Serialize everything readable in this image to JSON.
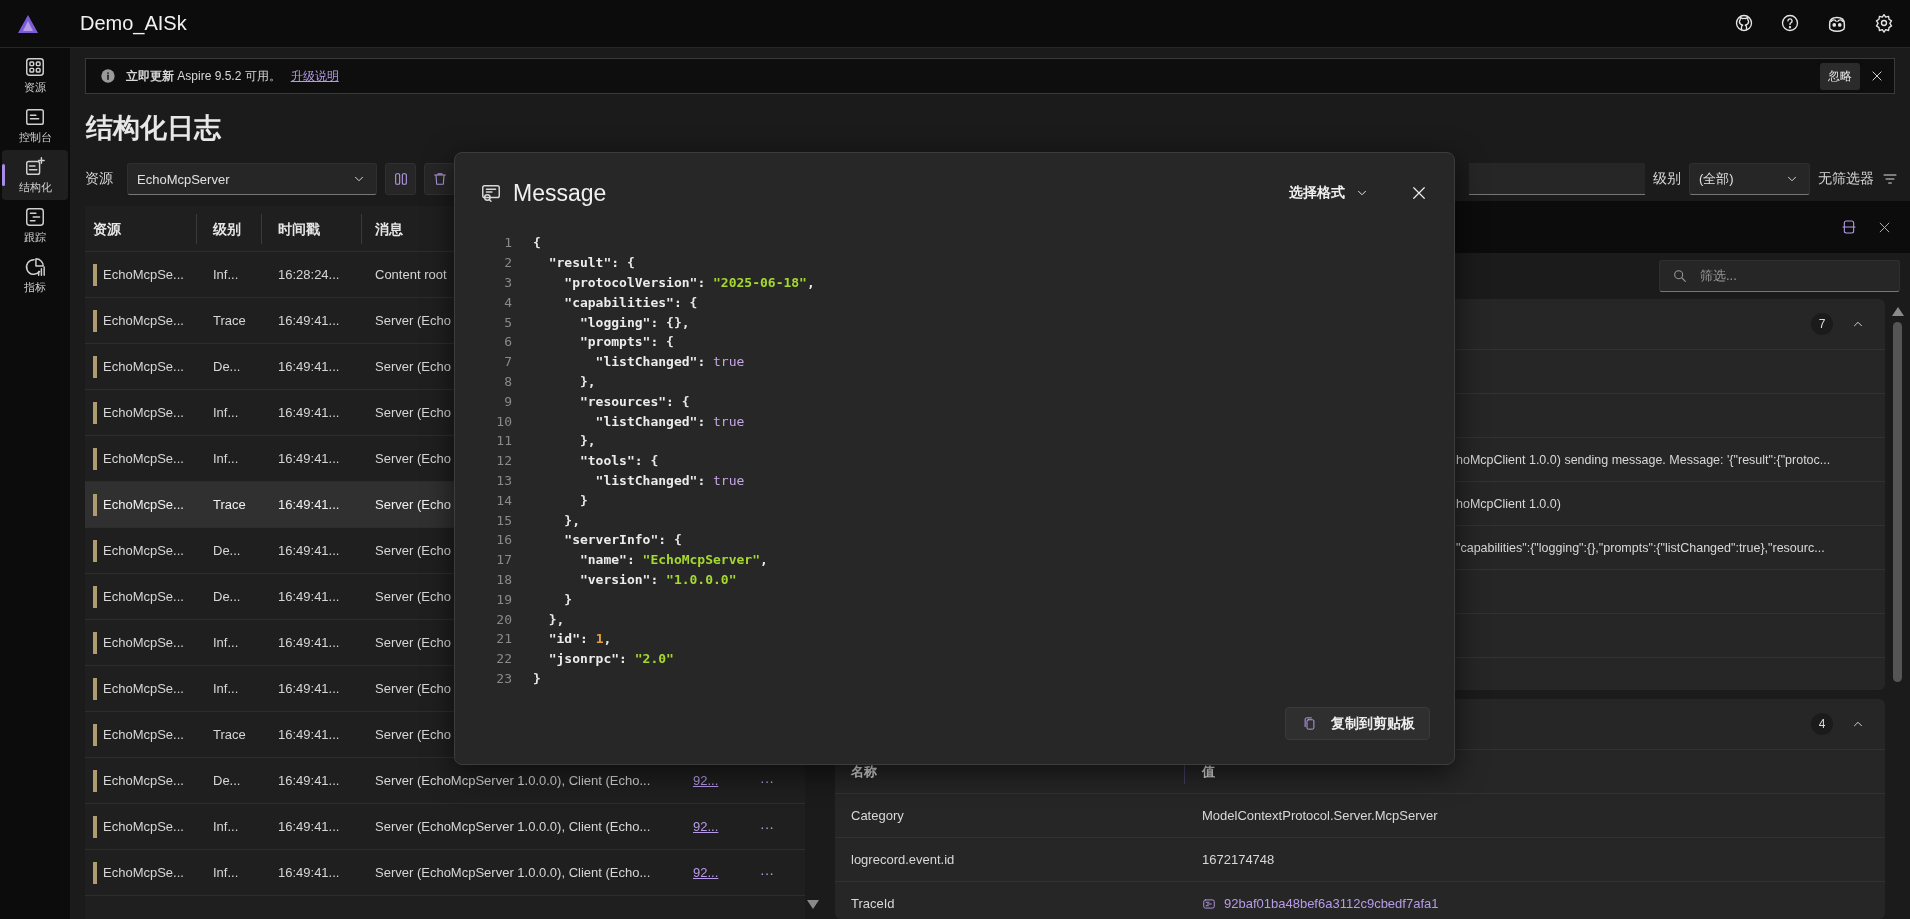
{
  "app": {
    "title": "Demo_AISk"
  },
  "sidebar": {
    "items": [
      {
        "label": "资源",
        "selected": false
      },
      {
        "label": "控制台",
        "selected": false
      },
      {
        "label": "结构化",
        "selected": true
      },
      {
        "label": "跟踪",
        "selected": false
      },
      {
        "label": "指标",
        "selected": false
      }
    ]
  },
  "banner": {
    "text": "**立即更新** Aspire 9.5.2 可用。",
    "link": "升级说明",
    "dismiss_button": "忽略"
  },
  "page_title": "结构化日志",
  "toolbar": {
    "resource_label": "资源",
    "resource_value": "EchoMcpServer",
    "level_label": "级别",
    "level_value": "(全部)",
    "filter_status": "无筛选器"
  },
  "log_table": {
    "columns": [
      "资源",
      "级别",
      "时间戳",
      "消息"
    ],
    "rows": [
      {
        "resource": "EchoMcpSe...",
        "level": "Inf...",
        "timestamp": "16:28:24...",
        "message": "Content root",
        "selected": false
      },
      {
        "resource": "EchoMcpSe...",
        "level": "Trace",
        "timestamp": "16:49:41...",
        "message": "Server (Echo",
        "selected": false
      },
      {
        "resource": "EchoMcpSe...",
        "level": "De...",
        "timestamp": "16:49:41...",
        "message": "Server (Echo",
        "selected": false
      },
      {
        "resource": "EchoMcpSe...",
        "level": "Inf...",
        "timestamp": "16:49:41...",
        "message": "Server (Echo",
        "selected": false
      },
      {
        "resource": "EchoMcpSe...",
        "level": "Inf...",
        "timestamp": "16:49:41...",
        "message": "Server (Echo",
        "selected": false
      },
      {
        "resource": "EchoMcpSe...",
        "level": "Trace",
        "timestamp": "16:49:41...",
        "message": "Server (Echo",
        "selected": true
      },
      {
        "resource": "EchoMcpSe...",
        "level": "De...",
        "timestamp": "16:49:41...",
        "message": "Server (Echo",
        "selected": false
      },
      {
        "resource": "EchoMcpSe...",
        "level": "De...",
        "timestamp": "16:49:41...",
        "message": "Server (Echo",
        "selected": false
      },
      {
        "resource": "EchoMcpSe...",
        "level": "Inf...",
        "timestamp": "16:49:41...",
        "message": "Server (Echo",
        "selected": false
      },
      {
        "resource": "EchoMcpSe...",
        "level": "Inf...",
        "timestamp": "16:49:41...",
        "message": "Server (Echo",
        "selected": false
      },
      {
        "resource": "EchoMcpSe...",
        "level": "Trace",
        "timestamp": "16:49:41...",
        "message": "Server (Echo",
        "selected": false
      },
      {
        "resource": "EchoMcpSe...",
        "level": "De...",
        "timestamp": "16:49:41...",
        "message": "Server (EchoMcpServer 1.0.0.0), Client (Echo...",
        "trace": "92...",
        "actions": "···",
        "selected": false
      },
      {
        "resource": "EchoMcpSe...",
        "level": "Inf...",
        "timestamp": "16:49:41...",
        "message": "Server (EchoMcpServer 1.0.0.0), Client (Echo...",
        "trace": "92...",
        "actions": "···",
        "selected": false
      },
      {
        "resource": "EchoMcpSe...",
        "level": "Inf...",
        "timestamp": "16:49:41...",
        "message": "Server (EchoMcpServer 1.0.0.0), Client (Echo...",
        "trace": "92...",
        "actions": "···",
        "selected": false
      }
    ]
  },
  "details": {
    "filter_placeholder": "筛选...",
    "sections": [
      {
        "count": "7",
        "expanded": true,
        "rows": [
          {
            "value": "hoMcpClient 1.0.0) sending message. Message: '{\"result\":{\"protoc..."
          },
          {
            "value": "hoMcpClient 1.0.0)"
          },
          {
            "value": "\"capabilities\":{\"logging\":{},\"prompts\":{\"listChanged\":true},\"resourc..."
          }
        ]
      },
      {
        "count": "4",
        "expanded": true,
        "columns": [
          "名称",
          "值"
        ],
        "rows": [
          {
            "name": "Category",
            "value": "ModelContextProtocol.Server.McpServer",
            "kind": "text"
          },
          {
            "name": "logrecord.event.id",
            "value": "1672174748",
            "kind": "text"
          },
          {
            "name": "TraceId",
            "value": "92baf01ba48bef6a3112c9cbedf7afa1",
            "kind": "trace-link"
          }
        ]
      }
    ]
  },
  "message_dialog": {
    "title": "Message",
    "format_menu": "选择格式",
    "copy_button": "复制到剪贴板",
    "lines": [
      {
        "number": "1",
        "tokens": [
          {
            "kind": "plain",
            "text": "{"
          }
        ]
      },
      {
        "number": "2",
        "tokens": [
          {
            "kind": "key",
            "text": "  \"result\""
          },
          {
            "kind": "plain",
            "text": ": {"
          }
        ]
      },
      {
        "number": "3",
        "tokens": [
          {
            "kind": "key",
            "text": "    \"protocolVersion\""
          },
          {
            "kind": "plain",
            "text": ": "
          },
          {
            "kind": "string",
            "text": "\"2025-06-18\""
          },
          {
            "kind": "plain",
            "text": ","
          }
        ]
      },
      {
        "number": "4",
        "tokens": [
          {
            "kind": "key",
            "text": "    \"capabilities\""
          },
          {
            "kind": "plain",
            "text": ": {"
          }
        ]
      },
      {
        "number": "5",
        "tokens": [
          {
            "kind": "key",
            "text": "      \"logging\""
          },
          {
            "kind": "plain",
            "text": ": {},"
          }
        ]
      },
      {
        "number": "6",
        "tokens": [
          {
            "kind": "key",
            "text": "      \"prompts\""
          },
          {
            "kind": "plain",
            "text": ": {"
          }
        ]
      },
      {
        "number": "7",
        "tokens": [
          {
            "kind": "key",
            "text": "        \"listChanged\""
          },
          {
            "kind": "plain",
            "text": ": "
          },
          {
            "kind": "boolean",
            "text": "true"
          }
        ]
      },
      {
        "number": "8",
        "tokens": [
          {
            "kind": "plain",
            "text": "      },"
          }
        ]
      },
      {
        "number": "9",
        "tokens": [
          {
            "kind": "key",
            "text": "      \"resources\""
          },
          {
            "kind": "plain",
            "text": ": {"
          }
        ]
      },
      {
        "number": "10",
        "tokens": [
          {
            "kind": "key",
            "text": "        \"listChanged\""
          },
          {
            "kind": "plain",
            "text": ": "
          },
          {
            "kind": "boolean",
            "text": "true"
          }
        ]
      },
      {
        "number": "11",
        "tokens": [
          {
            "kind": "plain",
            "text": "      },"
          }
        ]
      },
      {
        "number": "12",
        "tokens": [
          {
            "kind": "key",
            "text": "      \"tools\""
          },
          {
            "kind": "plain",
            "text": ": {"
          }
        ]
      },
      {
        "number": "13",
        "tokens": [
          {
            "kind": "key",
            "text": "        \"listChanged\""
          },
          {
            "kind": "plain",
            "text": ": "
          },
          {
            "kind": "boolean",
            "text": "true"
          }
        ]
      },
      {
        "number": "14",
        "tokens": [
          {
            "kind": "plain",
            "text": "      }"
          }
        ]
      },
      {
        "number": "15",
        "tokens": [
          {
            "kind": "plain",
            "text": "    },"
          }
        ]
      },
      {
        "number": "16",
        "tokens": [
          {
            "kind": "key",
            "text": "    \"serverInfo\""
          },
          {
            "kind": "plain",
            "text": ": {"
          }
        ]
      },
      {
        "number": "17",
        "tokens": [
          {
            "kind": "key",
            "text": "      \"name\""
          },
          {
            "kind": "plain",
            "text": ": "
          },
          {
            "kind": "string",
            "text": "\"EchoMcpServer\""
          },
          {
            "kind": "plain",
            "text": ","
          }
        ]
      },
      {
        "number": "18",
        "tokens": [
          {
            "kind": "key",
            "text": "      \"version\""
          },
          {
            "kind": "plain",
            "text": ": "
          },
          {
            "kind": "string",
            "text": "\"1.0.0.0\""
          }
        ]
      },
      {
        "number": "19",
        "tokens": [
          {
            "kind": "plain",
            "text": "    }"
          }
        ]
      },
      {
        "number": "20",
        "tokens": [
          {
            "kind": "plain",
            "text": "  },"
          }
        ]
      },
      {
        "number": "21",
        "tokens": [
          {
            "kind": "key",
            "text": "  \"id\""
          },
          {
            "kind": "plain",
            "text": ": "
          },
          {
            "kind": "number",
            "text": "1"
          },
          {
            "kind": "plain",
            "text": ","
          }
        ]
      },
      {
        "number": "22",
        "tokens": [
          {
            "kind": "key",
            "text": "  \"jsonrpc\""
          },
          {
            "kind": "plain",
            "text": ": "
          },
          {
            "kind": "string",
            "text": "\"2.0\""
          }
        ]
      },
      {
        "number": "23",
        "tokens": [
          {
            "kind": "plain",
            "text": "}"
          }
        ]
      }
    ]
  }
}
